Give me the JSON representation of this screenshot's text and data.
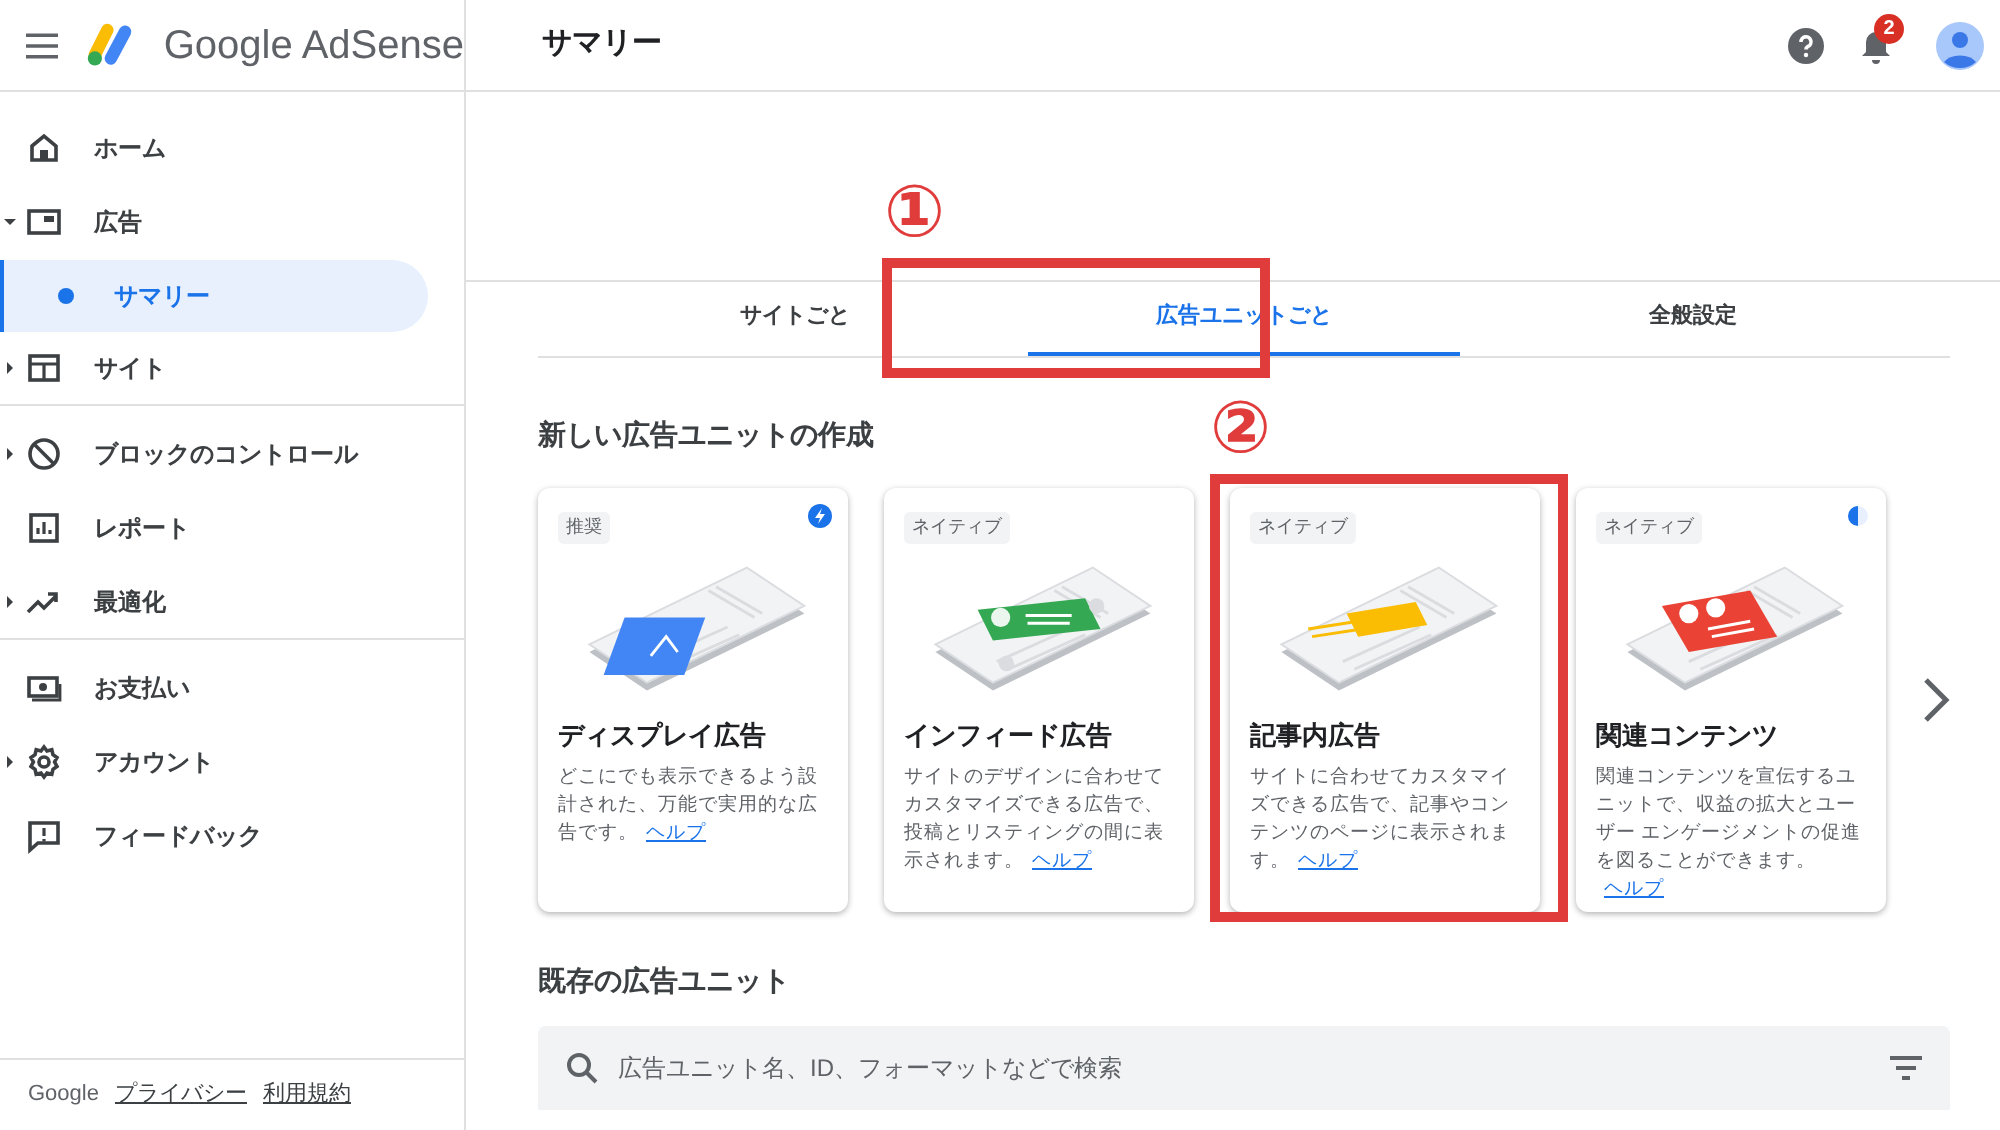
{
  "header": {
    "product": "Google AdSense",
    "page_title": "サマリー",
    "notification_count": "2"
  },
  "sidebar": {
    "items": [
      {
        "label": "ホーム",
        "expandable": false,
        "selected": false,
        "divider_after": false
      },
      {
        "label": "広告",
        "expandable": true,
        "expanded": true,
        "selected": false,
        "divider_after": false,
        "children": [
          {
            "label": "サマリー",
            "selected": true
          }
        ]
      },
      {
        "label": "サイト",
        "expandable": true,
        "expanded": false,
        "selected": false,
        "divider_after": true
      },
      {
        "label": "ブロックのコントロール",
        "expandable": true,
        "expanded": false,
        "selected": false,
        "divider_after": false
      },
      {
        "label": "レポート",
        "expandable": false,
        "selected": false,
        "divider_after": false
      },
      {
        "label": "最適化",
        "expandable": true,
        "expanded": false,
        "selected": false,
        "divider_after": true
      },
      {
        "label": "お支払い",
        "expandable": false,
        "selected": false,
        "divider_after": false
      },
      {
        "label": "アカウント",
        "expandable": true,
        "expanded": false,
        "selected": false,
        "divider_after": false
      },
      {
        "label": "フィードバック",
        "expandable": false,
        "selected": false,
        "divider_after": false
      }
    ],
    "footer": {
      "brand": "Google",
      "links": [
        "プライバシー",
        "利用規約"
      ]
    }
  },
  "tabs": [
    {
      "label": "サイトごと",
      "selected": false
    },
    {
      "label": "広告ユニットごと",
      "selected": true
    },
    {
      "label": "全般設定",
      "selected": false
    }
  ],
  "new_section": {
    "title": "新しい広告ユニットの作成",
    "cards": [
      {
        "kind": "display",
        "badge": "推奨",
        "title": "ディスプレイ広告",
        "description": "どこにでも表示できるよう設計された、万能で実用的な広告です。",
        "link": "ヘルプ"
      },
      {
        "kind": "infeed",
        "badge": "ネイティブ",
        "title": "インフィード広告",
        "description": "サイトのデザインに合わせてカスタマイズできる広告で、投稿とリスティングの間に表示されます。",
        "link": "ヘルプ"
      },
      {
        "kind": "inarticle",
        "badge": "ネイティブ",
        "title": "記事内広告",
        "description": "サイトに合わせてカスタマイズできる広告で、記事やコンテンツのページに表示されます。",
        "link": "ヘルプ"
      },
      {
        "kind": "matched",
        "badge": "ネイティブ",
        "title": "関連コンテンツ",
        "description": "関連コンテンツを宣伝するユニットで、収益の拡大とユーザー エンゲージメントの促進を図ることができます。",
        "link": "ヘルプ"
      }
    ]
  },
  "existing_section": {
    "title": "既存の広告ユニット",
    "search": {
      "placeholder": "広告ユニット名、ID、フォーマットなどで検索"
    }
  },
  "annotations": [
    {
      "number": "①"
    },
    {
      "number": "②"
    }
  ]
}
